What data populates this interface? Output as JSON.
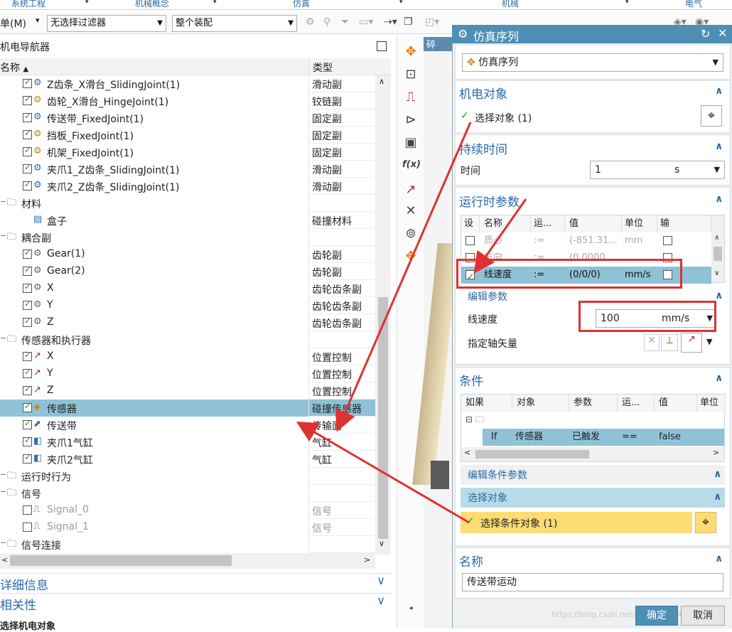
{
  "ribbon": {
    "groups": [
      "系统工程",
      "机械概念",
      "仿真",
      "机械",
      "电气"
    ]
  },
  "toolbar": {
    "menu_label": "单(M)",
    "filter_value": "无选择过滤器",
    "assembly_value": "整个装配"
  },
  "navigator": {
    "title": "机电导航器",
    "col_name": "名称",
    "col_type": "类型",
    "rows": [
      {
        "label": "Z齿条_X滑台_SlidingJoint(1)",
        "type": "滑动副"
      },
      {
        "label": "齿轮_X滑台_HingeJoint(1)",
        "type": "铰链副"
      },
      {
        "label": "传送带_FixedJoint(1)",
        "type": "固定副"
      },
      {
        "label": "挡板_FixedJoint(1)",
        "type": "固定副"
      },
      {
        "label": "机架_FixedJoint(1)",
        "type": "固定副"
      },
      {
        "label": "夹爪1_Z齿条_SlidingJoint(1)",
        "type": "滑动副"
      },
      {
        "label": "夹爪2_Z齿条_SlidingJoint(1)",
        "type": "滑动副"
      },
      {
        "label": "材料",
        "type": ""
      },
      {
        "label": "盒子",
        "type": "碰撞材料"
      },
      {
        "label": "耦合副",
        "type": ""
      },
      {
        "label": "Gear(1)",
        "type": "齿轮副"
      },
      {
        "label": "Gear(2)",
        "type": "齿轮副"
      },
      {
        "label": "X",
        "type": "齿轮齿条副"
      },
      {
        "label": "Y",
        "type": "齿轮齿条副"
      },
      {
        "label": "Z",
        "type": "齿轮齿条副"
      },
      {
        "label": "传感器和执行器",
        "type": ""
      },
      {
        "label": "X",
        "type": "位置控制"
      },
      {
        "label": "Y",
        "type": "位置控制"
      },
      {
        "label": "Z",
        "type": "位置控制"
      },
      {
        "label": "传感器",
        "type": "碰撞传感器"
      },
      {
        "label": "传送带",
        "type": "传输面"
      },
      {
        "label": "夹爪1气缸",
        "type": "气缸"
      },
      {
        "label": "夹爪2气缸",
        "type": "气缸"
      },
      {
        "label": "运行时行为",
        "type": ""
      },
      {
        "label": "信号",
        "type": ""
      },
      {
        "label": "Signal_0",
        "type": "信号"
      },
      {
        "label": "Signal_1",
        "type": "信号"
      },
      {
        "label": "信号连接",
        "type": ""
      }
    ],
    "details_label": "详细信息",
    "relations_label": "相关性",
    "status": "选择机电对象"
  },
  "viewport": {
    "tab_label": "碎"
  },
  "dialog": {
    "title": "仿真序列",
    "type_value": "仿真序列",
    "mech_title": "机电对象",
    "select_object": "选择对象 (1)",
    "duration_title": "持续时间",
    "time_label": "时间",
    "time_value": "1",
    "time_unit": "s",
    "runtime_title": "运行时参数",
    "param_headers": [
      "设",
      "名称",
      "运...",
      "值",
      "单位",
      "输"
    ],
    "param_rows": [
      {
        "name": "质心",
        "op": ":=",
        "value": "(-851.31...",
        "unit": "mm"
      },
      {
        "name": "方向",
        "op": ":=",
        "value": "(0.0000...",
        "unit": ""
      },
      {
        "name": "线速度",
        "op": ":=",
        "value": "(0/0/0)",
        "unit": "mm/s"
      }
    ],
    "edit_param_title": "编辑参数",
    "speed_label": "线速度",
    "speed_value": "100",
    "speed_unit": "mm/s",
    "axis_label": "指定轴矢量",
    "cond_title": "条件",
    "cond_headers": [
      "如果",
      "对象",
      "参数",
      "运...",
      "值",
      "单位"
    ],
    "cond_row": {
      "if": "If",
      "object": "传感器",
      "param": "已触发",
      "op": "==",
      "value": "false"
    },
    "edit_cond_title": "编辑条件参数",
    "select_obj_title": "选择对象",
    "select_cond_object": "选择条件对象 (1)",
    "name_title": "名称",
    "name_value": "传送带运动",
    "ok": "确定",
    "cancel": "取消",
    "watermark": "https://blog.csdn.net/...42920524"
  },
  "colors": {
    "accent": "#2b6aa7",
    "title_bar": "#4e8fb6",
    "selected_row": "#8fc2d6",
    "highlight": "#fddc74",
    "annotation": "#e03131"
  }
}
